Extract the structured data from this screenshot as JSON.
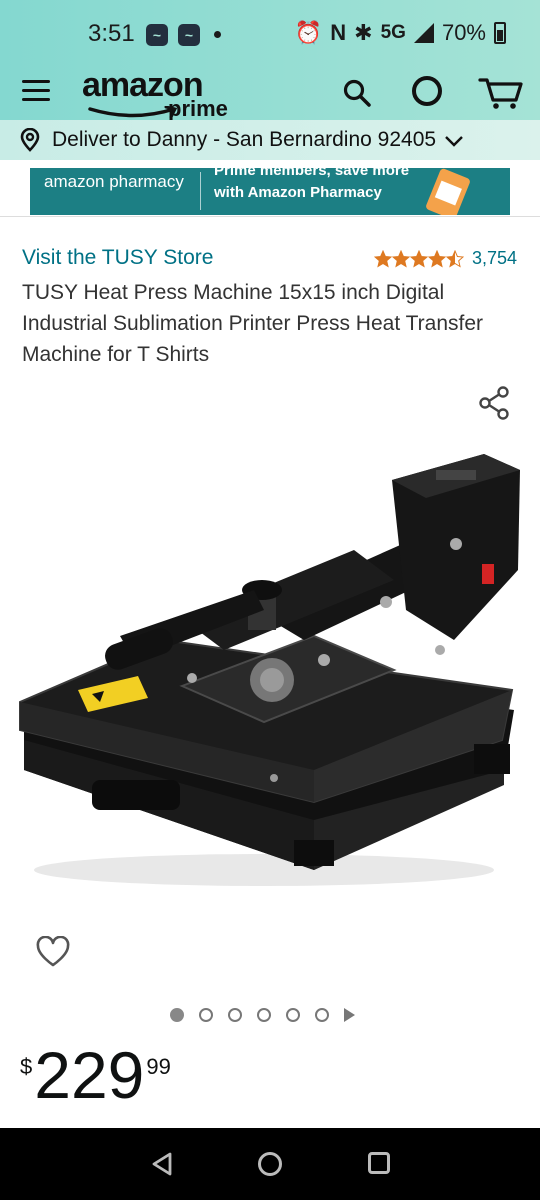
{
  "status_bar": {
    "time": "3:51",
    "network": "5G",
    "battery": "70%"
  },
  "header": {
    "logo_text": "amazon",
    "logo_sub": "prime",
    "icons": [
      "menu-icon",
      "search-icon",
      "alexa-icon",
      "cart-icon"
    ]
  },
  "delivery": {
    "text": "Deliver to Danny - San Bernardino 92405"
  },
  "banner": {
    "brand": "amazon pharmacy",
    "line1": "Prime members, save more",
    "line2": "with Amazon Pharmacy"
  },
  "product": {
    "store_link": "Visit the TUSY Store",
    "rating": 4.5,
    "rating_count": "3,754",
    "title": "TUSY Heat Press Machine 15x15 inch Digital Industrial Sublimation Printer Press Heat Transfer Machine for T Shirts"
  },
  "carousel": {
    "total": 6,
    "active": 0
  },
  "price": {
    "symbol": "$",
    "whole": "229",
    "fraction": "99"
  },
  "colors": {
    "header_bg": "#a5e3d6",
    "link": "#007185",
    "star": "#de7921",
    "banner_bg": "#1c7f84"
  }
}
